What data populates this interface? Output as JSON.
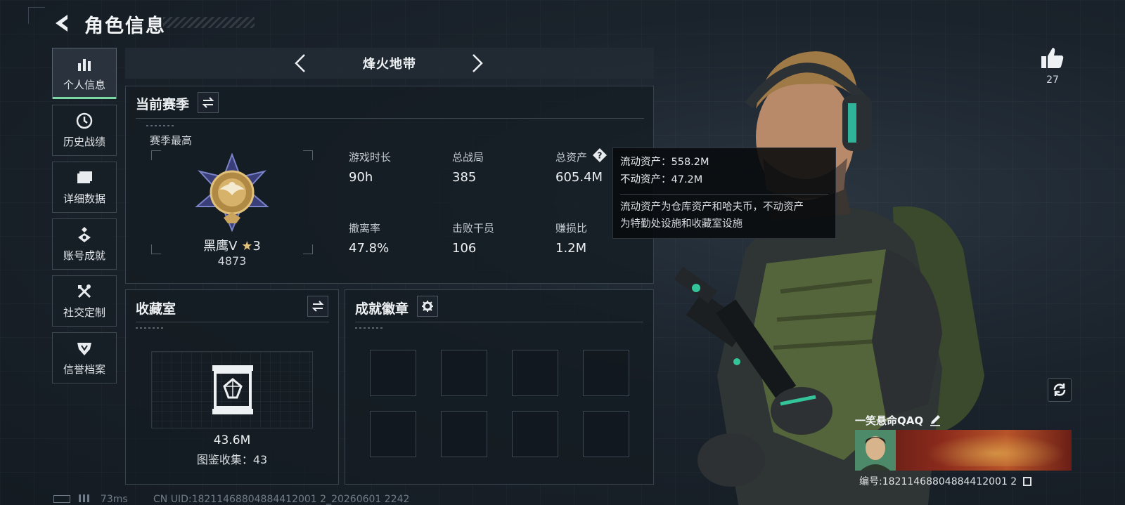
{
  "header": {
    "title": "角色信息"
  },
  "sidebar": {
    "items": [
      {
        "label": "个人信息",
        "icon": "bar-chart-icon",
        "active": true
      },
      {
        "label": "历史战绩",
        "icon": "history-icon",
        "active": false
      },
      {
        "label": "详细数据",
        "icon": "folder-icon",
        "active": false
      },
      {
        "label": "账号成就",
        "icon": "achievement-icon",
        "active": false
      },
      {
        "label": "社交定制",
        "icon": "tools-icon",
        "active": false
      },
      {
        "label": "信誉档案",
        "icon": "shield-icon",
        "active": false
      }
    ]
  },
  "mode": {
    "name": "烽火地带"
  },
  "season": {
    "title": "当前赛季",
    "best_label": "赛季最高",
    "rank_name": "黑鹰V",
    "rank_stars": "3",
    "rank_score": "4873",
    "stats": [
      {
        "label": "游戏时长",
        "value": "90h"
      },
      {
        "label": "总战局",
        "value": "385"
      },
      {
        "label": "总资产",
        "value": "605.4M"
      },
      {
        "label": "撤离率",
        "value": "47.8%"
      },
      {
        "label": "击败干员",
        "value": "106"
      },
      {
        "label": "赚损比",
        "value": "1.2M"
      }
    ]
  },
  "tooltip": {
    "liquid": "流动资产：558.2M",
    "fixed": "不动资产：47.2M",
    "desc_line1": "流动资产为仓库资产和哈夫币，不动资产",
    "desc_line2": "为特勤处设施和收藏室设施"
  },
  "collection": {
    "title": "收藏室",
    "value": "43.6M",
    "count_text": "图鉴收集：43"
  },
  "badges": {
    "title": "成就徽章",
    "slots": 8
  },
  "right": {
    "like_count": "27",
    "player_name": "一笑悬命QAQ",
    "player_id": "编号:18211468804884412001 2"
  },
  "status": {
    "ping": "73ms",
    "uid": "CN UID:18211468804884412001 2_20260601 2242"
  },
  "colors": {
    "accent": "#7bd7a4",
    "panel_border": "#38434e",
    "tooltip_bg": "#08090a"
  }
}
